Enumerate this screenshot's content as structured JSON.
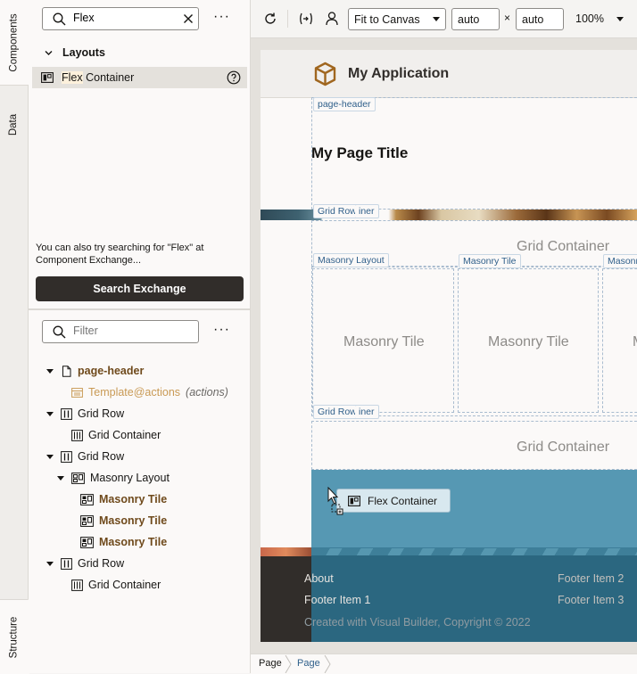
{
  "rail": {
    "components_tab": "Components",
    "data_tab": "Data",
    "structure_tab": "Structure"
  },
  "components": {
    "search_value": "Flex",
    "layouts_header": "Layouts",
    "result_highlight": "Flex",
    "result_rest": " Container",
    "hint_line1": "You can also try searching for \"Flex\" at",
    "hint_line2": "Component Exchange...",
    "exchange_button": "Search Exchange"
  },
  "structure": {
    "filter_placeholder": "Filter",
    "items": [
      {
        "label": "page-header",
        "extra": "",
        "note": ""
      },
      {
        "label": "Template",
        "extra": "@actions",
        "note": "(actions)"
      },
      {
        "label": "Grid Row",
        "extra": "",
        "note": ""
      },
      {
        "label": "Grid Container",
        "extra": "",
        "note": ""
      },
      {
        "label": "Grid Row",
        "extra": "",
        "note": ""
      },
      {
        "label": "Masonry Layout",
        "extra": "",
        "note": ""
      },
      {
        "label": "Masonry Tile",
        "extra": "",
        "note": ""
      },
      {
        "label": "Masonry Tile",
        "extra": "",
        "note": ""
      },
      {
        "label": "Masonry Tile",
        "extra": "",
        "note": ""
      },
      {
        "label": "Grid Row",
        "extra": "",
        "note": ""
      },
      {
        "label": "Grid Container",
        "extra": "",
        "note": ""
      }
    ]
  },
  "toolbar": {
    "fit_label": "Fit to Canvas",
    "width_value": "auto",
    "times": "×",
    "height_value": "auto",
    "zoom": "100%"
  },
  "canvas": {
    "app_title": "My Application",
    "page_header_label": "page-header",
    "page_title": "My Page Title",
    "grid_row_label": "Grid Row",
    "grid_container_label_cut": "iner",
    "grid_container_text": "Grid Container",
    "masonry_layout_label": "Masonry Layout",
    "masonry_tile_label": "Masonry Tile",
    "masonry_cut_label": "Masonr",
    "masonry_tile_text": "Masonry Tile",
    "masonry_cut_text": "M",
    "drag_label": "Flex Container",
    "footer": {
      "about": "About",
      "item1": "Footer Item 1",
      "item2": "Footer Item 2",
      "item3": "Footer Item 3",
      "copyright": "Created with Visual Builder, Copyright © 2022"
    }
  },
  "breadcrumb": {
    "item1": "Page",
    "item2": "Page"
  },
  "colors": {
    "accent_brown": "#6f4a1c",
    "button_dark": "#312d2a",
    "overlay_teal": "#3f8aa8",
    "footer_dark": "#312d2a"
  }
}
